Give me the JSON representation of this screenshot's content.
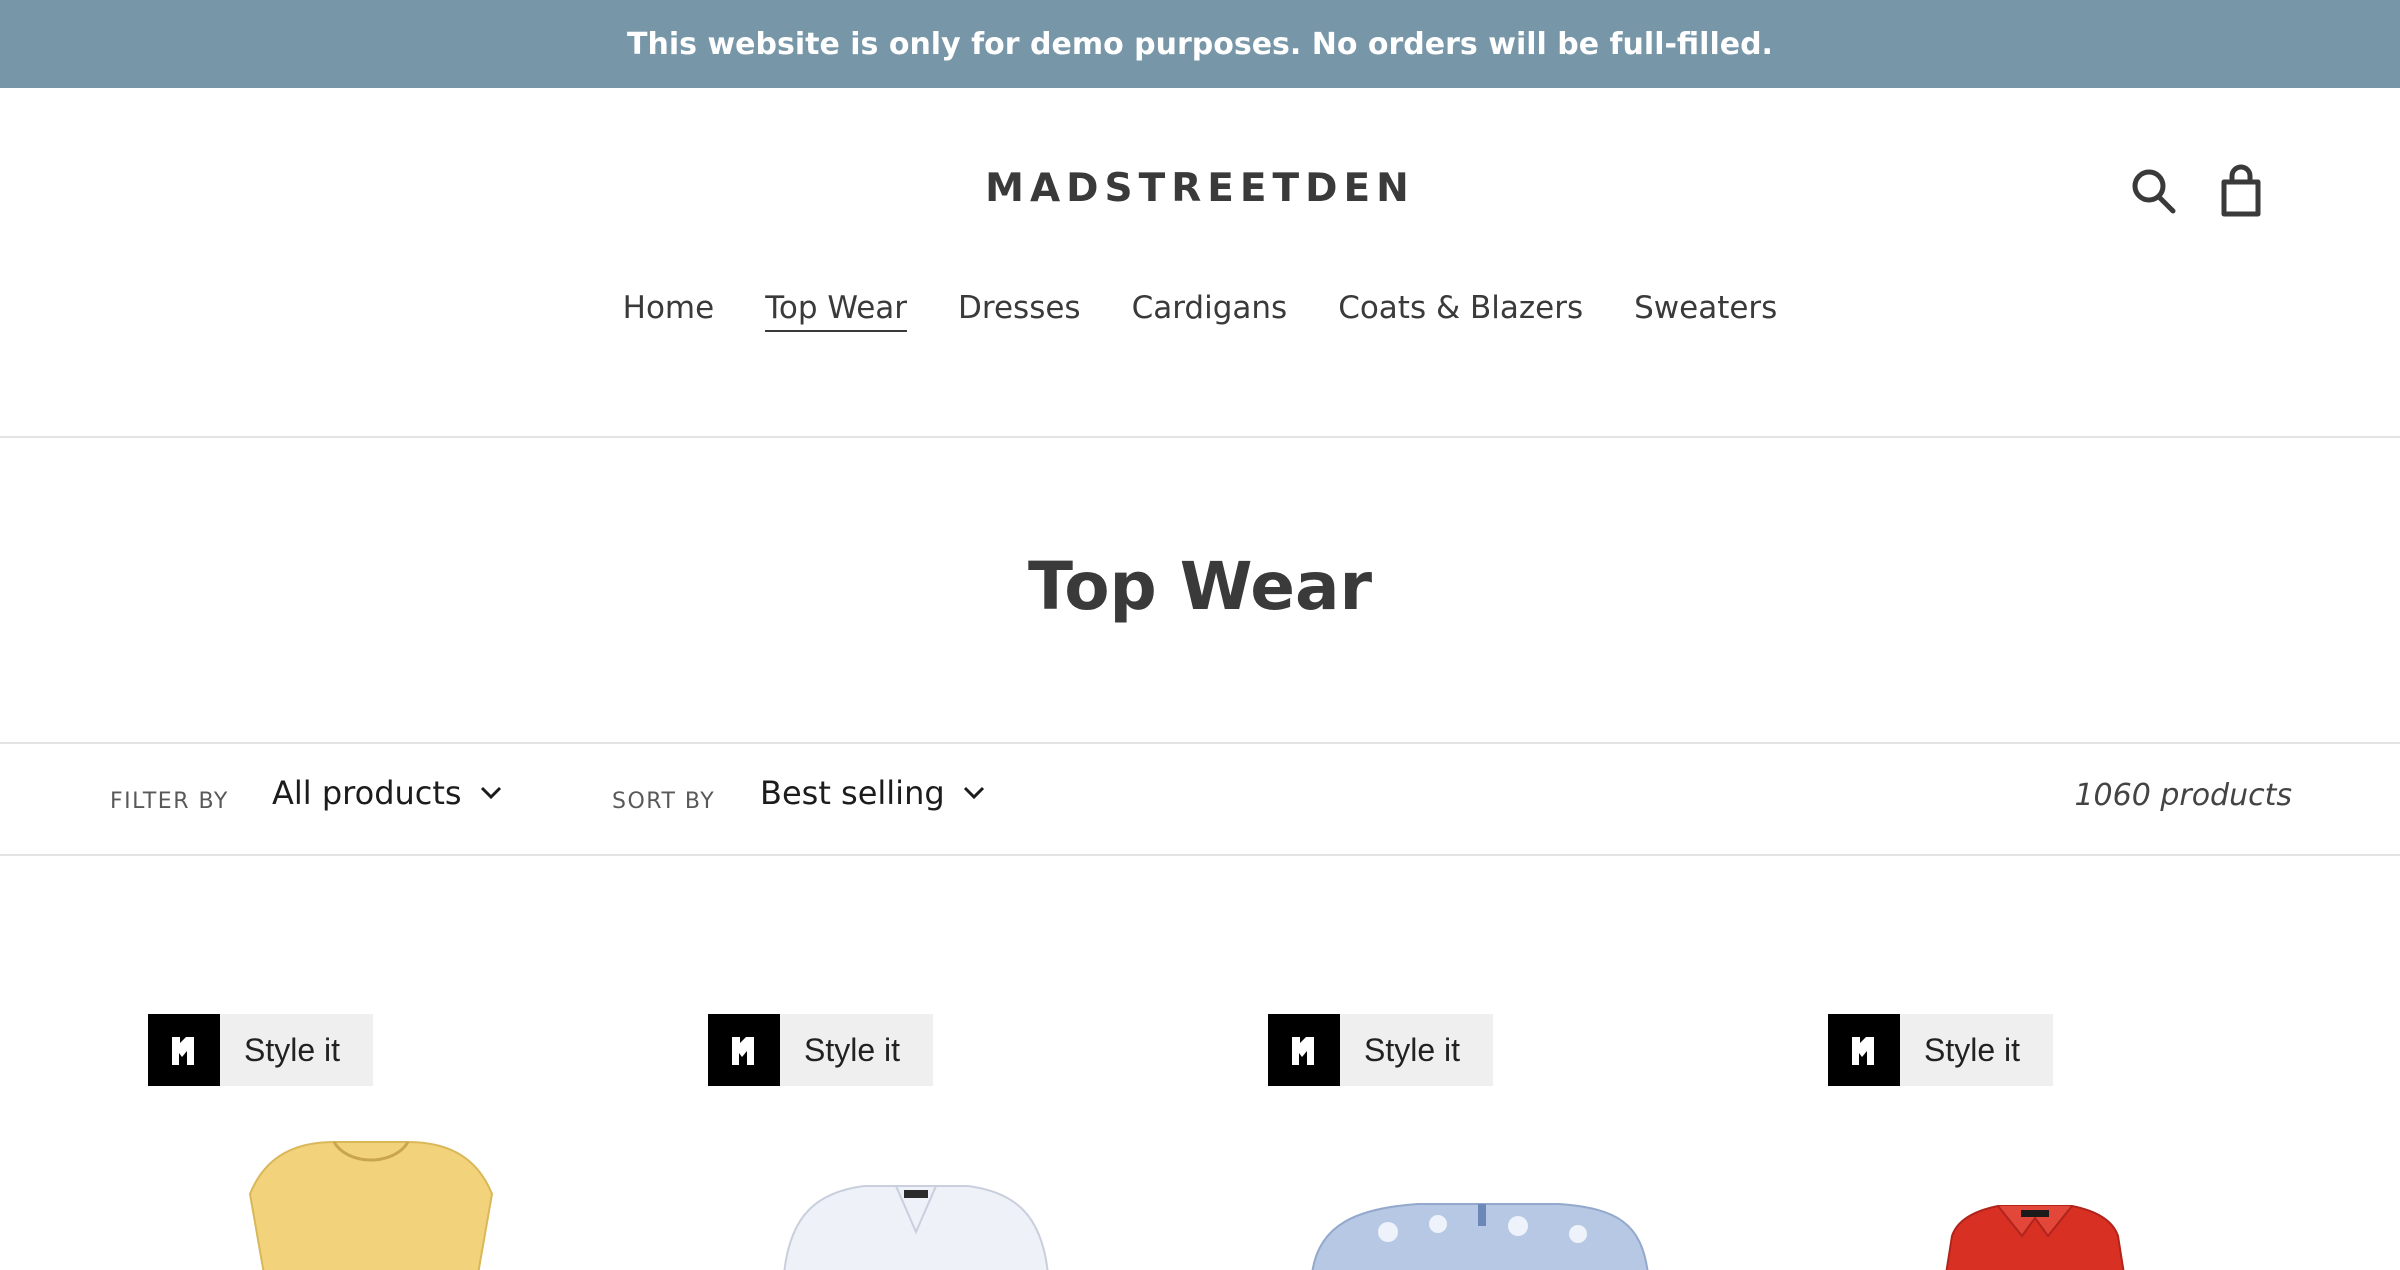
{
  "announcement": "This website is only for demo purposes. No orders will be full-filled.",
  "header": {
    "logo": "MADSTREETDEN",
    "search_icon": "search-icon",
    "cart_icon": "cart-icon"
  },
  "nav": [
    "Home",
    "Top Wear",
    "Dresses",
    "Cardigans",
    "Coats & Blazers",
    "Sweaters"
  ],
  "nav_active": "Top Wear",
  "page_title": "Top Wear",
  "filters": {
    "filter_label": "FILTER BY",
    "filter_value": "All products",
    "sort_label": "SORT BY",
    "sort_value": "Best selling",
    "count": "1060 products"
  },
  "products": [
    {
      "style_label": "Style it",
      "garment_color": "#f2d27a"
    },
    {
      "style_label": "Style it",
      "garment_color": "#eef1f8"
    },
    {
      "style_label": "Style it",
      "garment_color": "#b7c8e4"
    },
    {
      "style_label": "Style it",
      "garment_color": "#d93024"
    }
  ],
  "colors": {
    "announcement_bg": "#7796a8",
    "text": "#3a3a3a"
  }
}
